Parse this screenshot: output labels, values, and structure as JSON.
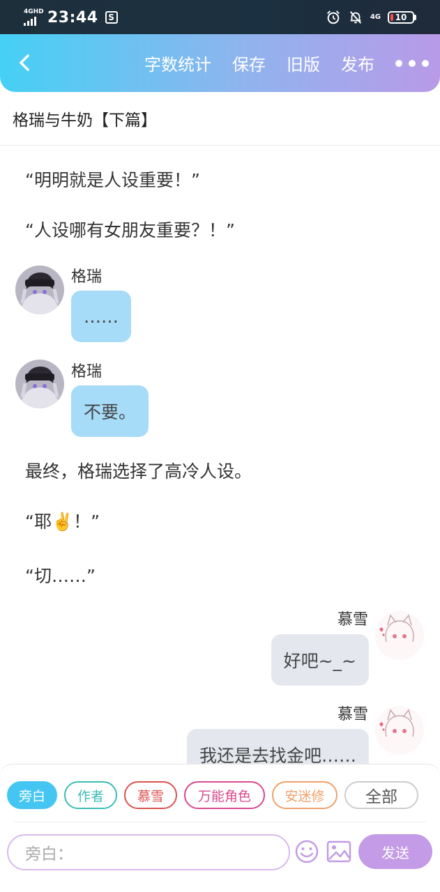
{
  "status_bar": {
    "network_label": "4GHD",
    "time": "23:44",
    "s_badge": "S",
    "lte_label": "4G",
    "battery": "10"
  },
  "toolbar": {
    "word_count": "字数统计",
    "save": "保存",
    "old_version": "旧版",
    "publish": "发布"
  },
  "document": {
    "title": "格瑞与牛奶【下篇】"
  },
  "messages": {
    "narr1": "“明明就是人设重要！”",
    "narr2": "“人设哪有女朋友重要？！”",
    "chat1_name": "格瑞",
    "chat1_text": "……",
    "chat2_name": "格瑞",
    "chat2_text": "不要。",
    "narr3": "最终，格瑞选择了高冷人设。",
    "narr4": "“耶✌️！”",
    "narr5": "“切……”",
    "chat3_name": "慕雪",
    "chat3_text": "好吧~_~",
    "chat4_name": "慕雪",
    "chat4_text": "我还是去找金吧……"
  },
  "roles": [
    {
      "label": "旁白",
      "color": "#45c6f2",
      "selected": true
    },
    {
      "label": "作者",
      "color": "#3bbcb4",
      "selected": false
    },
    {
      "label": "慕雪",
      "color": "#d9534f",
      "selected": false
    },
    {
      "label": "万能角色",
      "color": "#d9488f",
      "selected": false
    },
    {
      "label": "安迷修",
      "color": "#f0a06a",
      "selected": false
    },
    {
      "label": "全部",
      "color": "#cccccc",
      "selected": false
    }
  ],
  "composer": {
    "placeholder": "旁白：",
    "send": "发送"
  }
}
